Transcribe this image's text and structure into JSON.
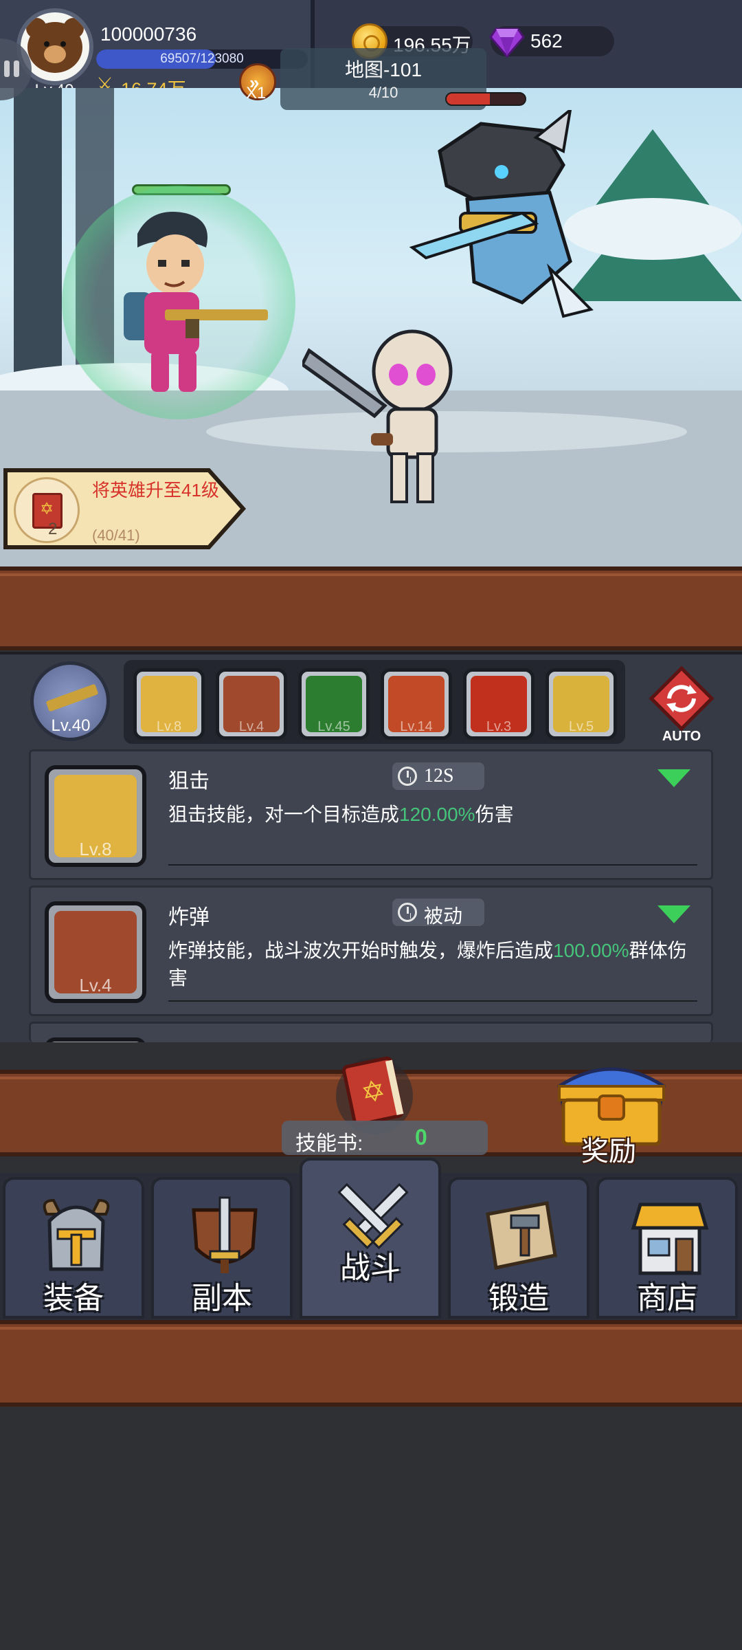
{
  "player": {
    "id": "100000736",
    "level": "Lv.40",
    "exp_text": "69507/123080",
    "exp_fraction": 0.5647,
    "power": "16.74万"
  },
  "currency": {
    "coins": "196.55万",
    "gems": "562"
  },
  "battle": {
    "speed": "X1",
    "map_title": "地图-101",
    "wave": "4/10",
    "boss_hp_fraction": 0.55
  },
  "quest": {
    "text": "将英雄升至41级",
    "progress": "(40/41)",
    "book_count": "2"
  },
  "skills_bar": {
    "weapon_level": "Lv.40",
    "icons": [
      {
        "level": "Lv.8",
        "icon": "sniper-icon",
        "color": "#e0b341"
      },
      {
        "level": "Lv.4",
        "icon": "bomb-icon",
        "color": "#a0492c"
      },
      {
        "level": "Lv.45",
        "icon": "poison-skull-icon",
        "color": "#2c7d2f"
      },
      {
        "level": "Lv.14",
        "icon": "monster-icon",
        "color": "#c24a26"
      },
      {
        "level": "Lv.3",
        "icon": "explosion-icon",
        "color": "#c0301c"
      },
      {
        "level": "Lv.5",
        "icon": "lightning-icon",
        "color": "#d9b23b"
      }
    ],
    "auto_label": "AUTO"
  },
  "skill_cards": [
    {
      "name": "狙击",
      "level": "Lv.8",
      "cooldown": "12S",
      "desc_before": "狙击技能，对一个目标造成",
      "desc_value": "120.00%",
      "desc_after": "伤害"
    },
    {
      "name": "炸弹",
      "level": "Lv.4",
      "cooldown": "被动",
      "desc_before": "炸弹技能，战斗波次开始时触发，爆炸后造成",
      "desc_value": "100.00%",
      "desc_after": "群体伤害"
    }
  ],
  "rewards": {
    "skillbook_label": "技能书:",
    "skillbook_count": "0",
    "reward_label": "奖励"
  },
  "nav": {
    "tabs": [
      {
        "label": "装备",
        "icon": "helmet-icon"
      },
      {
        "label": "副本",
        "icon": "sword-shield-icon"
      },
      {
        "label": "战斗",
        "icon": "crossed-swords-icon",
        "active": true
      },
      {
        "label": "锻造",
        "icon": "blueprint-hammer-icon"
      },
      {
        "label": "商店",
        "icon": "shop-icon"
      }
    ]
  },
  "colors": {
    "highlight_green": "#45c57a",
    "quest_red": "#d7322a",
    "wood": "#7a3f25",
    "panel": "#363a44"
  }
}
